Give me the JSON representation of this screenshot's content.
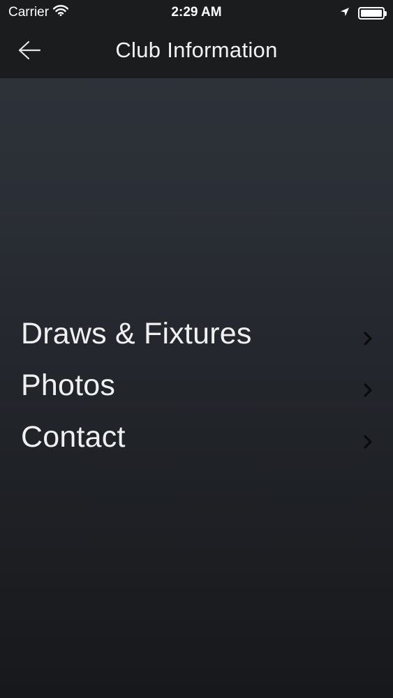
{
  "status_bar": {
    "carrier": "Carrier",
    "time": "2:29 AM",
    "icons": [
      "wifi-icon",
      "location-arrow-icon",
      "battery-icon"
    ]
  },
  "nav": {
    "title": "Club Information",
    "back_icon": "back-arrow-icon"
  },
  "menu": {
    "items": [
      {
        "label": "Draws & Fixtures",
        "icon": "chevron-right-icon"
      },
      {
        "label": "Photos",
        "icon": "chevron-right-icon"
      },
      {
        "label": "Contact",
        "icon": "chevron-right-icon"
      }
    ]
  },
  "colors": {
    "header_bg": "#1b1c1e",
    "background_top": "#2f333b",
    "background_bottom": "#17181b",
    "text": "#ffffff",
    "chevron": "#0a0a0a"
  }
}
